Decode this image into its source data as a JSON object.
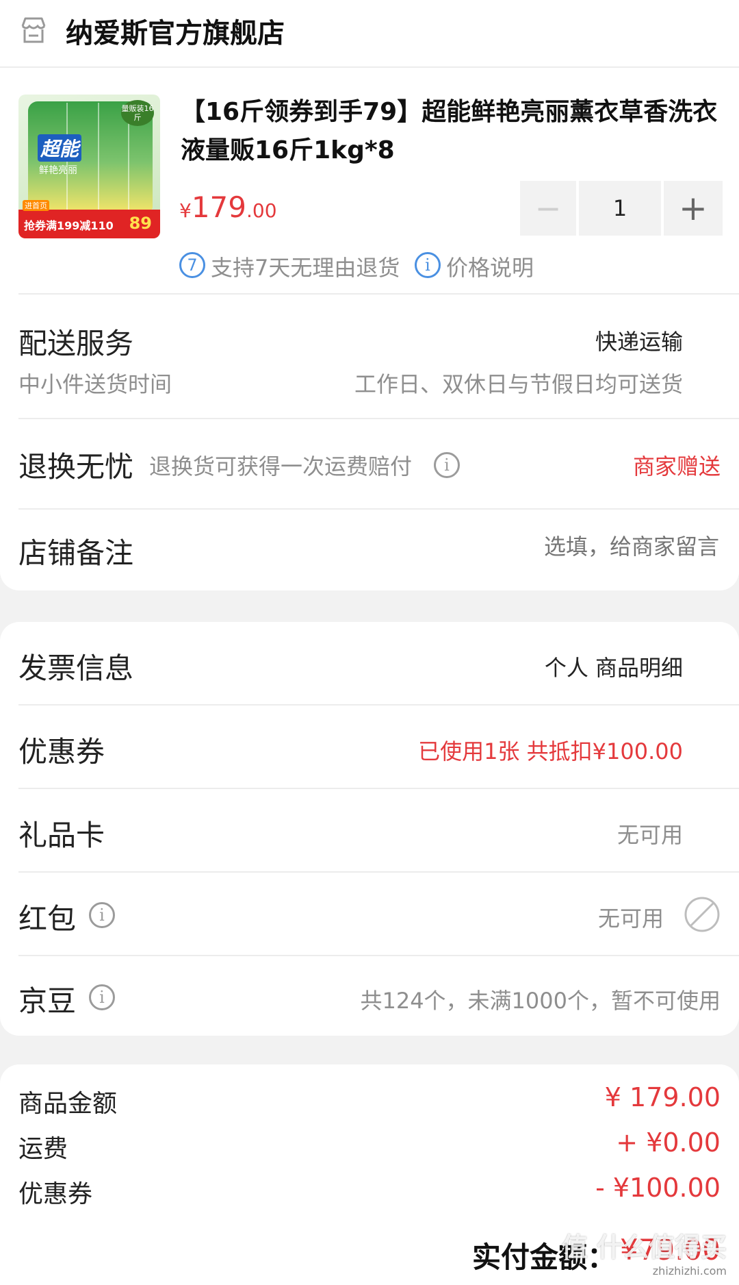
{
  "shop": {
    "name": "纳爱斯官方旗舰店",
    "icon": "store-icon"
  },
  "product": {
    "title": "【16斤领券到手79】超能鲜艳亮丽薰衣草香洗衣液量贩16斤1kg*8",
    "price_symbol": "¥",
    "price_int": "179",
    "price_dec": ".00",
    "quantity": "1",
    "minus": "−",
    "plus": "+",
    "return_badge": "7",
    "return_text": "支持7天无理由退货",
    "price_info_badge": "i",
    "price_info_text": "价格说明",
    "image": {
      "brand": "超能",
      "sub": "鲜艳亮丽",
      "corner": "量贩装16斤",
      "promo": "抢券满199减110",
      "promo_price": "89",
      "promo_tag": "进首页"
    }
  },
  "delivery": {
    "label": "配送服务",
    "value": "快递运输",
    "sub_label": "中小件送货时间",
    "sub_value": "工作日、双休日与节假日均可送货"
  },
  "returns": {
    "label": "退换无忧",
    "desc": "退换货可获得一次运费赔付",
    "value": "商家赠送"
  },
  "note": {
    "label": "店铺备注",
    "placeholder": "选填，给商家留言"
  },
  "invoice": {
    "label": "发票信息",
    "value": "个人 商品明细"
  },
  "coupon": {
    "label": "优惠券",
    "value": "已使用1张 共抵扣¥100.00"
  },
  "gift_card": {
    "label": "礼品卡",
    "value": "无可用"
  },
  "red_packet": {
    "label": "红包",
    "value": "无可用"
  },
  "jingdou": {
    "label": "京豆",
    "value": "共124个，未满1000个，暂不可使用"
  },
  "summary": {
    "goods_label": "商品金额",
    "goods_value": "¥ 179.00",
    "shipping_label": "运费",
    "shipping_value": "+ ¥0.00",
    "coupon_label": "优惠券",
    "coupon_value": "- ¥100.00",
    "pay_label": "实付金额：",
    "pay_value": "¥79.00"
  },
  "watermark": {
    "main": "值 什么值得买",
    "url": "zhizhizhi.com"
  },
  "colors": {
    "accent": "#e4393c",
    "blue": "#4a90e2",
    "gray_text": "#8e8e8e"
  }
}
